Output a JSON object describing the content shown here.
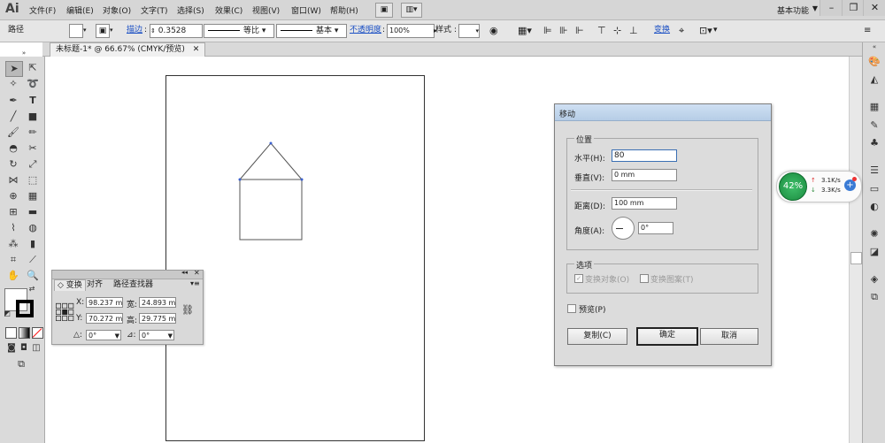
{
  "app": {
    "logo": "Ai",
    "menu": [
      "文件(F)",
      "编辑(E)",
      "对象(O)",
      "文字(T)",
      "选择(S)",
      "效果(C)",
      "视图(V)",
      "窗口(W)",
      "帮助(H)"
    ],
    "workspace": "基本功能",
    "window_controls": [
      "–",
      "❐",
      "✕"
    ]
  },
  "controlbar": {
    "selection_label": "路径",
    "stroke_label": "描边",
    "stroke_weight": "0.3528",
    "profile_label": "等比",
    "brush_label": "基本",
    "opacity_label": "不透明度",
    "opacity_value": "100%",
    "style_label": "样式",
    "transform_link": "变换"
  },
  "document": {
    "tab_title": "未标题-1* @ 66.67% (CMYK/预览)"
  },
  "transform_panel": {
    "tabs": [
      "变换",
      "对齐",
      "路径查找器"
    ],
    "x_label": "X:",
    "x_value": "98.237 m",
    "w_label": "宽:",
    "w_value": "24.893 m",
    "y_label": "Y:",
    "y_value": "70.272 m",
    "h_label": "高:",
    "h_value": "29.775 m",
    "rotate_label": "△:",
    "rotate_value": "0°",
    "shear_label": "⊿:",
    "shear_value": "0°"
  },
  "move_dialog": {
    "title": "移动",
    "position_group": "位置",
    "horizontal_label": "水平(H):",
    "horizontal_value": "80",
    "vertical_label": "垂直(V):",
    "vertical_value": "0 mm",
    "distance_label": "距离(D):",
    "distance_value": "100 mm",
    "angle_label": "角度(A):",
    "angle_value": "0°",
    "options_group": "选项",
    "transform_objects": "变换对象(O)",
    "transform_patterns": "变换图案(T)",
    "preview_label": "预览(P)",
    "copy_button": "复制(C)",
    "ok_button": "确定",
    "cancel_button": "取消"
  },
  "speed_widget": {
    "percent": "42%",
    "upload": "3.1K/s",
    "download": "3.3K/s"
  },
  "colors": {
    "dialog_title": "#b6cde6",
    "link_blue": "#1a4fc4",
    "speed_green": "#1a8a3f"
  }
}
